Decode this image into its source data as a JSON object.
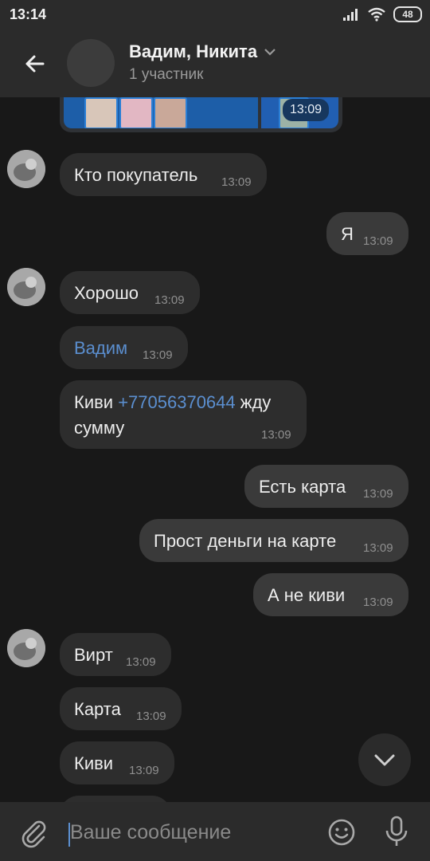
{
  "status": {
    "time": "13:14",
    "battery": "48",
    "icons": [
      "signal-icon",
      "wifi-icon",
      "battery-icon"
    ]
  },
  "header": {
    "title": "Вадим, Никита",
    "subtitle": "1 участник"
  },
  "photo_group": {
    "time": "13:09"
  },
  "messages": [
    {
      "text": "Кто покупатель",
      "time": "13:09",
      "direction": "in"
    },
    {
      "text": "Я",
      "time": "13:09",
      "direction": "out"
    },
    {
      "text": "Хорошо",
      "time": "13:09",
      "direction": "in"
    },
    {
      "text": "Вадим",
      "time": "13:09",
      "direction": "in"
    },
    {
      "text_before": "Киви ",
      "link": "+77056370644",
      "text_after": " жду",
      "line2": "сумму",
      "time": "13:09",
      "direction": "in"
    },
    {
      "text": "Есть карта",
      "time": "13:09",
      "direction": "out"
    },
    {
      "text": "Прост деньги на карте",
      "time": "13:09",
      "direction": "out"
    },
    {
      "text": "А не киви",
      "time": "13:09",
      "direction": "out"
    },
    {
      "text": "Вирт",
      "time": "13:09",
      "direction": "in"
    },
    {
      "text": "Карта",
      "time": "13:09",
      "direction": "in"
    },
    {
      "text": "Киви",
      "time": "13:09",
      "direction": "in"
    }
  ],
  "composer": {
    "placeholder": "Ваше сообщение"
  },
  "colors": {
    "background": "#181818",
    "bar": "#2b2b2b",
    "bubble_in": "#2d2d2d",
    "bubble_out": "#3a3a3a",
    "link": "#5b8fd0"
  }
}
